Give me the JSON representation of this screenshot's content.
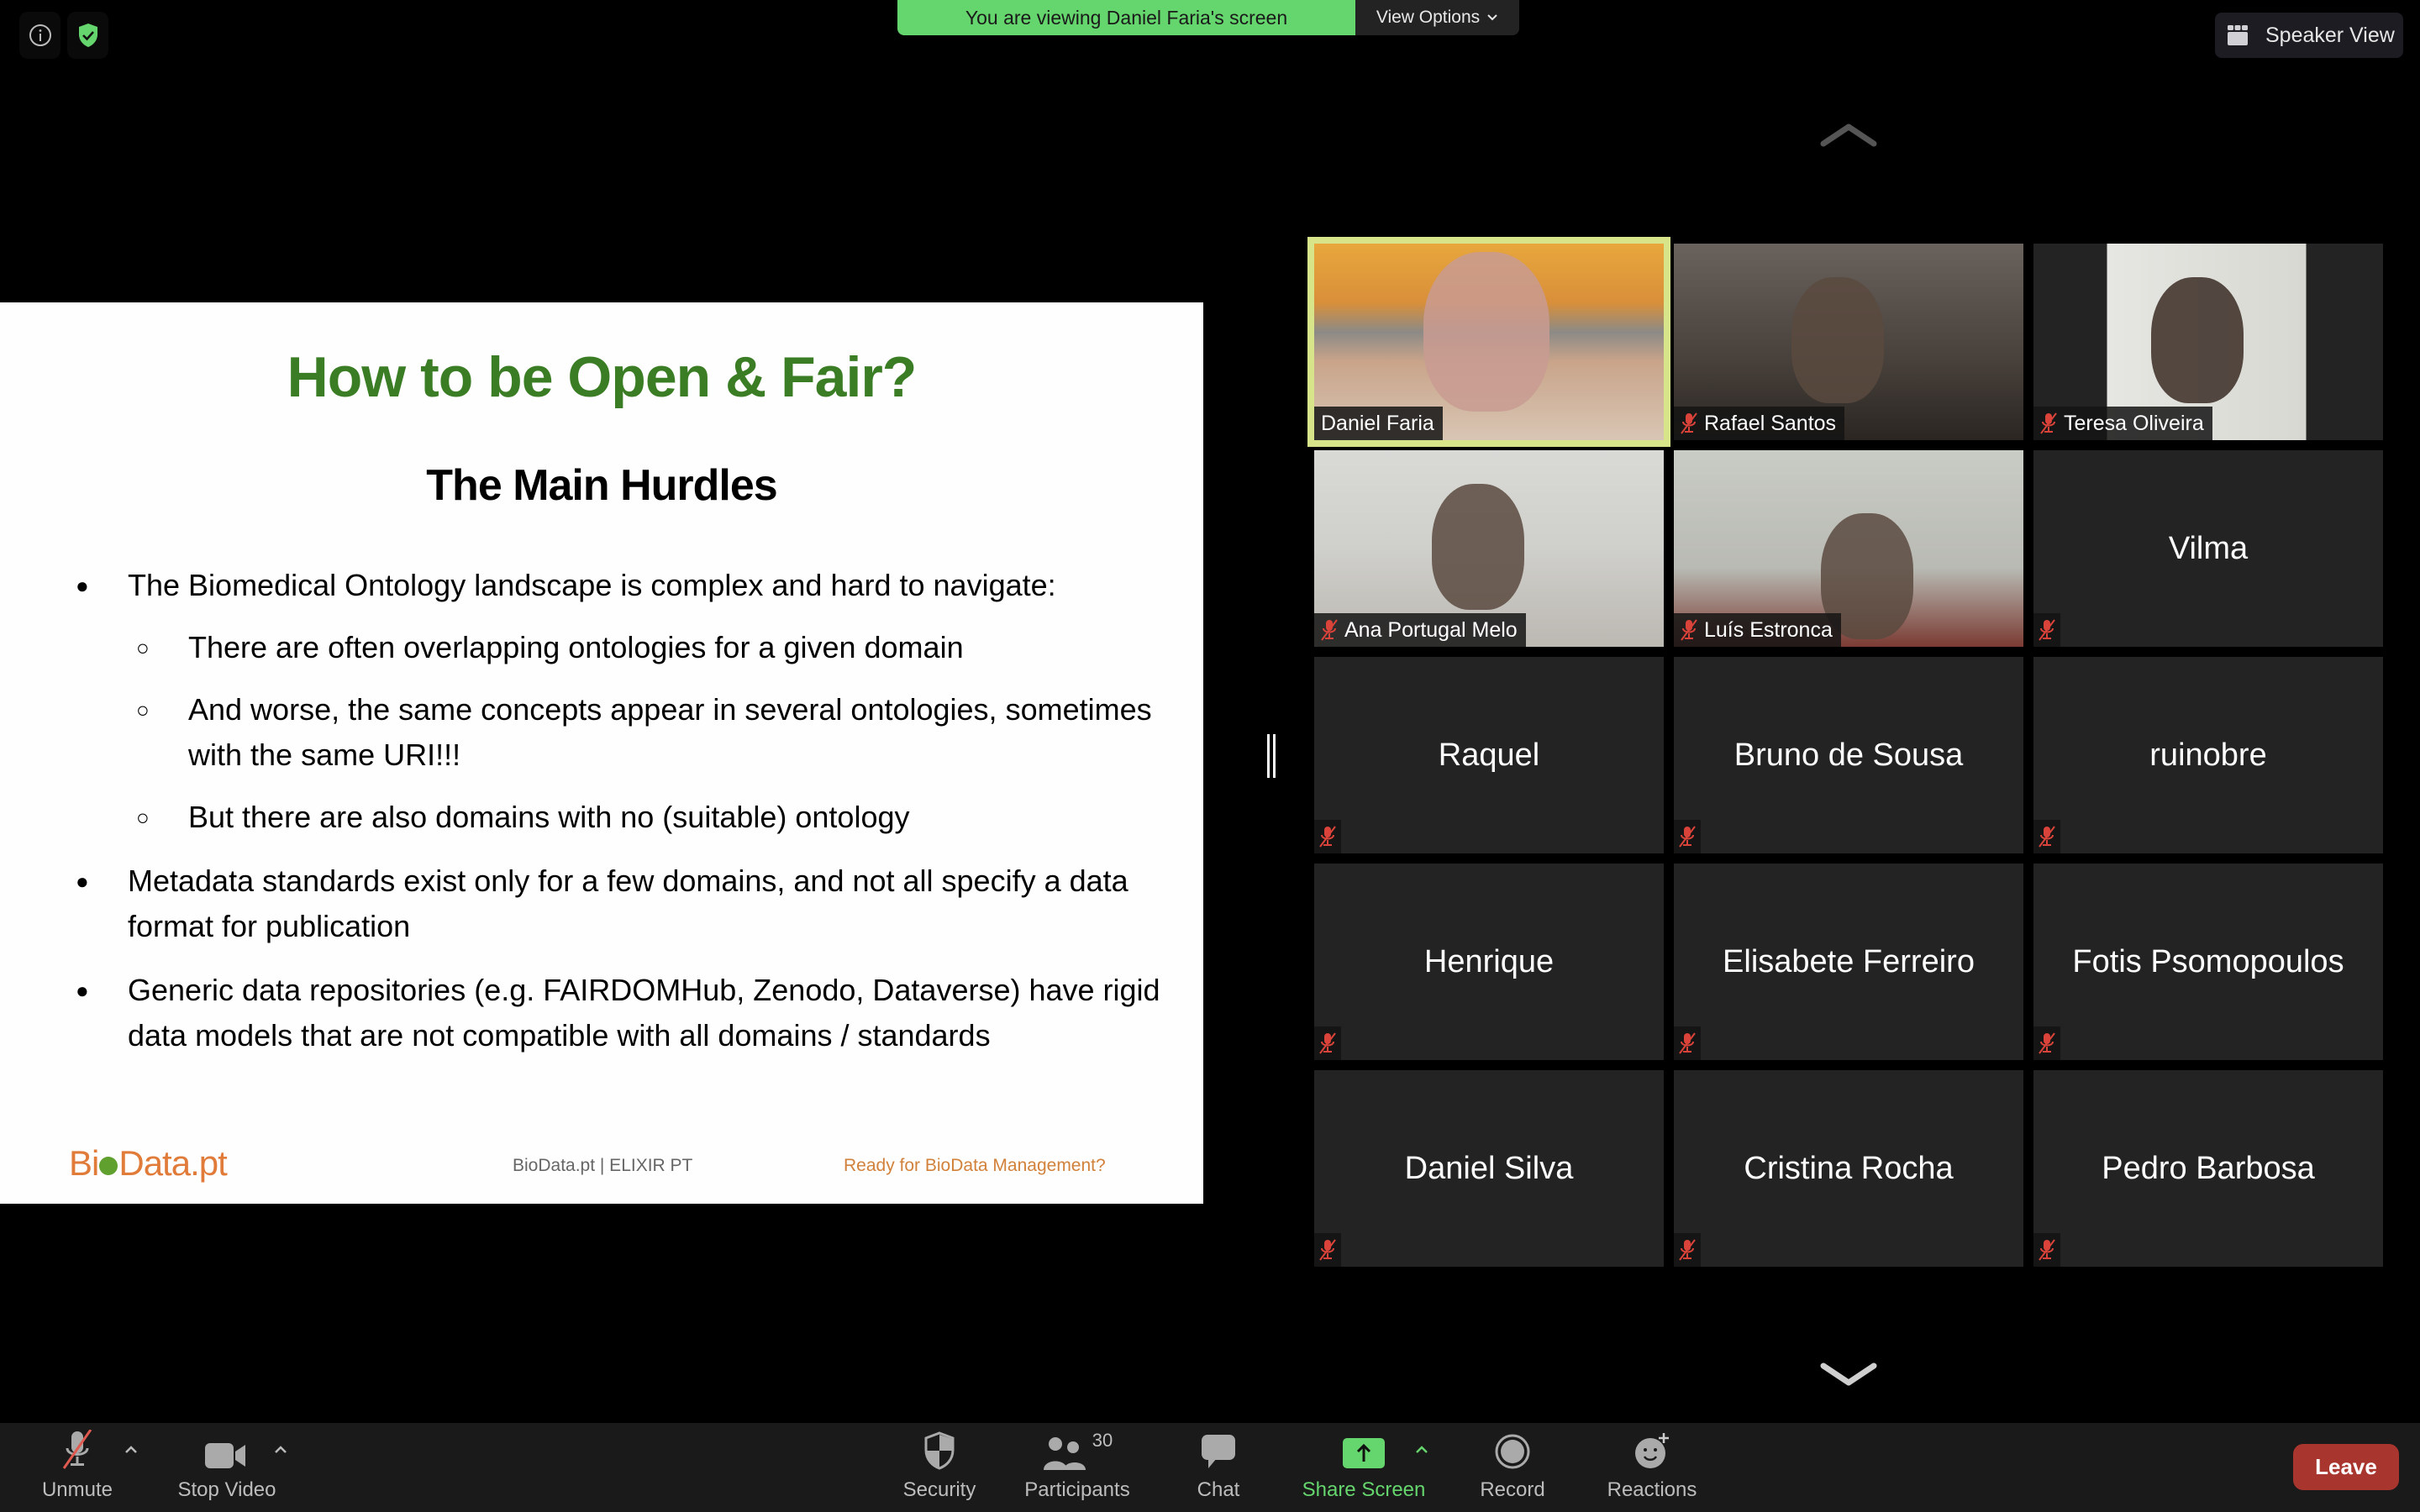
{
  "banner": {
    "text": "You are viewing Daniel Faria's screen",
    "view_options": "View Options"
  },
  "top_right": {
    "speaker_view": "Speaker View"
  },
  "slide": {
    "title": "How to be Open & Fair?",
    "subtitle": "The Main Hurdles",
    "bullets": [
      {
        "text": "The Biomedical Ontology landscape is complex and hard to navigate:",
        "sub": [
          "There are often overlapping ontologies for a given domain",
          "And worse, the same concepts appear in several ontologies, sometimes with the same URI!!!",
          "But there are also domains with no (suitable) ontology"
        ]
      },
      {
        "text": "Metadata standards exist only for a few domains, and not all specify a data format for publication"
      },
      {
        "text": "Generic data repositories (e.g. FAIRDOMHub, Zenodo, Dataverse) have rigid data models that are not compatible with all domains / standards"
      }
    ],
    "footer": {
      "logo_pre": "Bi",
      "logo_post": "Data.pt",
      "middle": "BioData.pt | ELIXIR PT",
      "right": "Ready for BioData Management?"
    },
    "colors": {
      "title": "#3a7d24",
      "logo": "#e07b39"
    }
  },
  "participants": [
    {
      "name": "Daniel Faria",
      "video": true,
      "muted": false,
      "active_speaker": true
    },
    {
      "name": "Rafael Santos",
      "video": true,
      "muted": true
    },
    {
      "name": "Teresa Oliveira",
      "video": true,
      "muted": true
    },
    {
      "name": "Ana Portugal Melo",
      "video": true,
      "muted": true
    },
    {
      "name": "Luís Estronca",
      "video": true,
      "muted": true
    },
    {
      "name": "Vilma",
      "video": false,
      "muted": true
    },
    {
      "name": "Raquel",
      "video": false,
      "muted": true
    },
    {
      "name": "Bruno de Sousa",
      "video": false,
      "muted": true
    },
    {
      "name": "ruinobre",
      "video": false,
      "muted": true
    },
    {
      "name": "Henrique",
      "video": false,
      "muted": true
    },
    {
      "name": "Elisabete Ferreiro",
      "video": false,
      "muted": true
    },
    {
      "name": "Fotis Psomopoulos",
      "video": false,
      "muted": true
    },
    {
      "name": "Daniel Silva",
      "video": false,
      "muted": true
    },
    {
      "name": "Cristina Rocha",
      "video": false,
      "muted": true
    },
    {
      "name": "Pedro Barbosa",
      "video": false,
      "muted": true
    }
  ],
  "toolbar": {
    "unmute": "Unmute",
    "stop_video": "Stop Video",
    "security": "Security",
    "participants": "Participants",
    "participant_count": "30",
    "chat": "Chat",
    "share_screen": "Share Screen",
    "record": "Record",
    "reactions": "Reactions",
    "leave": "Leave"
  },
  "colors": {
    "accent_green": "#65d56d",
    "leave_red": "#a9352f",
    "active_speaker_border": "#d8e48a",
    "mute_red": "#d9433a"
  }
}
